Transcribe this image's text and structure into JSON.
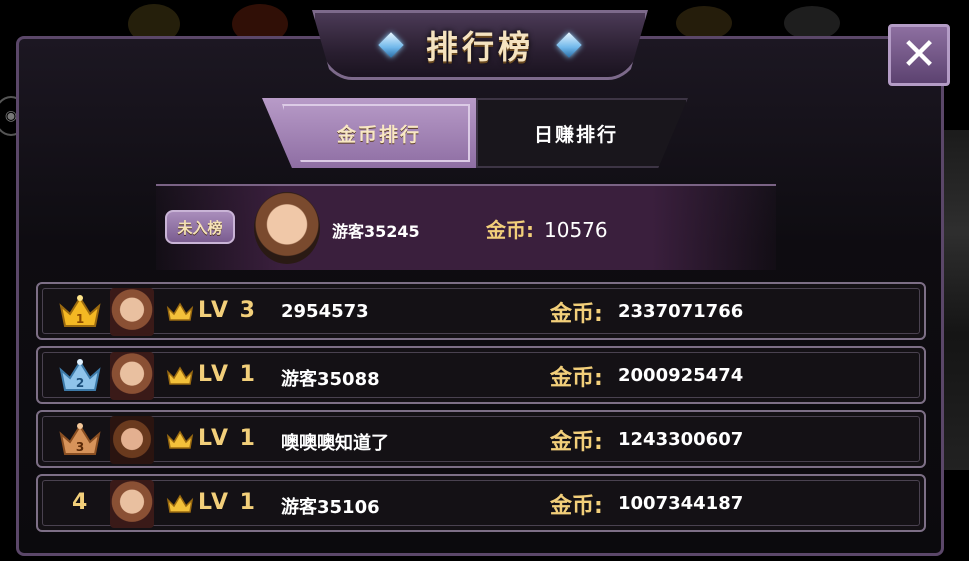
{
  "title": "排行榜",
  "tabs": [
    {
      "label": "金币排行",
      "active": true
    },
    {
      "label": "日赚排行",
      "active": false
    }
  ],
  "my_rank": {
    "badge": "未入榜",
    "name": "游客35245",
    "gold_label": "金币:",
    "gold": "10576"
  },
  "rows": [
    {
      "rank": "1",
      "level": "LV 3",
      "name": "2954573",
      "gold_label": "金币:",
      "gold": "2337071766",
      "crown": "gold-crown-icon"
    },
    {
      "rank": "2",
      "level": "LV 1",
      "name": "游客35088",
      "gold_label": "金币:",
      "gold": "2000925474",
      "crown": "silver-crown-icon"
    },
    {
      "rank": "3",
      "level": "LV 1",
      "name": "噢噢噢知道了",
      "gold_label": "金币:",
      "gold": "1243300607",
      "crown": "bronze-crown-icon"
    },
    {
      "rank": "4",
      "level": "LV 1",
      "name": "游客35106",
      "gold_label": "金币:",
      "gold": "1007344187",
      "crown": null
    }
  ],
  "colors": {
    "gold_text": "#f2cf7a",
    "panel_border": "#5b4769",
    "tab_active": "#a98dbb",
    "crown_gold": "#f3b823",
    "crown_silver": "#8fc4ea",
    "crown_bronze": "#d6935a"
  }
}
